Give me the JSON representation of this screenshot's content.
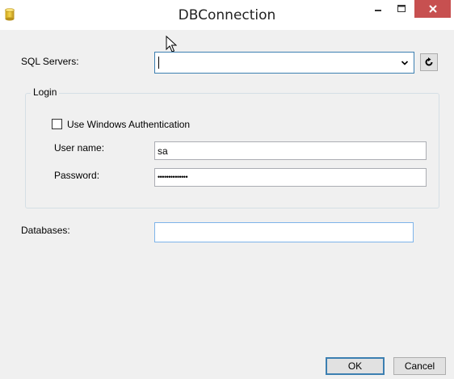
{
  "window": {
    "title": "DBConnection",
    "minimize_glyph": "–",
    "maximize_glyph": "☐",
    "close_glyph": "✕",
    "app_icon": "database-cylinder-icon",
    "close_color": "#c75050"
  },
  "sql_servers": {
    "label": "SQL Servers:",
    "value": "",
    "refresh_icon": "refresh-icon"
  },
  "login": {
    "group_label": "Login",
    "use_windows_auth_label": "Use Windows Authentication",
    "use_windows_auth_checked": false,
    "username_label": "User name:",
    "username_value": "sa",
    "password_label": "Password:",
    "password_value": "••••••••••••••"
  },
  "databases": {
    "label": "Databases:",
    "value": ""
  },
  "buttons": {
    "ok_label": "OK",
    "cancel_label": "Cancel"
  }
}
